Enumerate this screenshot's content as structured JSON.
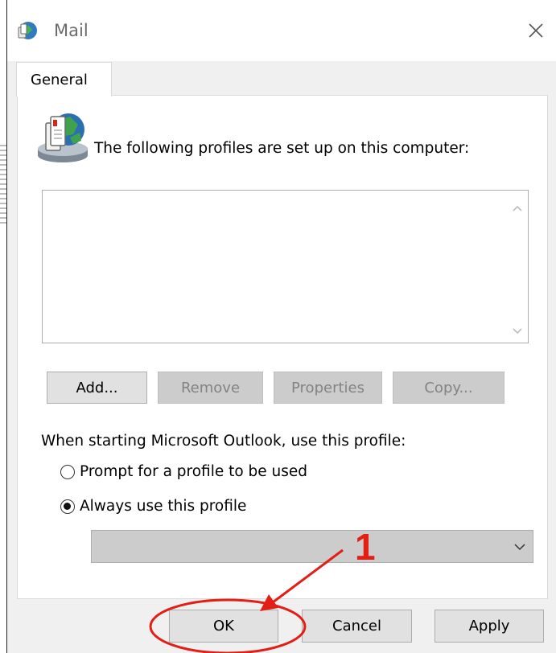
{
  "window": {
    "title": "Mail",
    "close_icon": "close-icon"
  },
  "tabs": [
    {
      "label": "General"
    }
  ],
  "profiles": {
    "heading": "The following profiles are set up on this computer:",
    "icon": "mail-profiles-icon",
    "list_items": []
  },
  "profile_buttons": {
    "add": "Add...",
    "remove": "Remove",
    "properties": "Properties",
    "copy": "Copy..."
  },
  "startup": {
    "label": "When starting Microsoft Outlook, use this profile:",
    "options": [
      {
        "label": "Prompt for a profile to be used",
        "selected": false
      },
      {
        "label": "Always use this profile",
        "selected": true
      }
    ],
    "profile_select_value": ""
  },
  "dialog_buttons": {
    "ok": "OK",
    "cancel": "Cancel",
    "apply": "Apply"
  },
  "annotation": {
    "step_number": "1",
    "color": "#e31e14"
  }
}
